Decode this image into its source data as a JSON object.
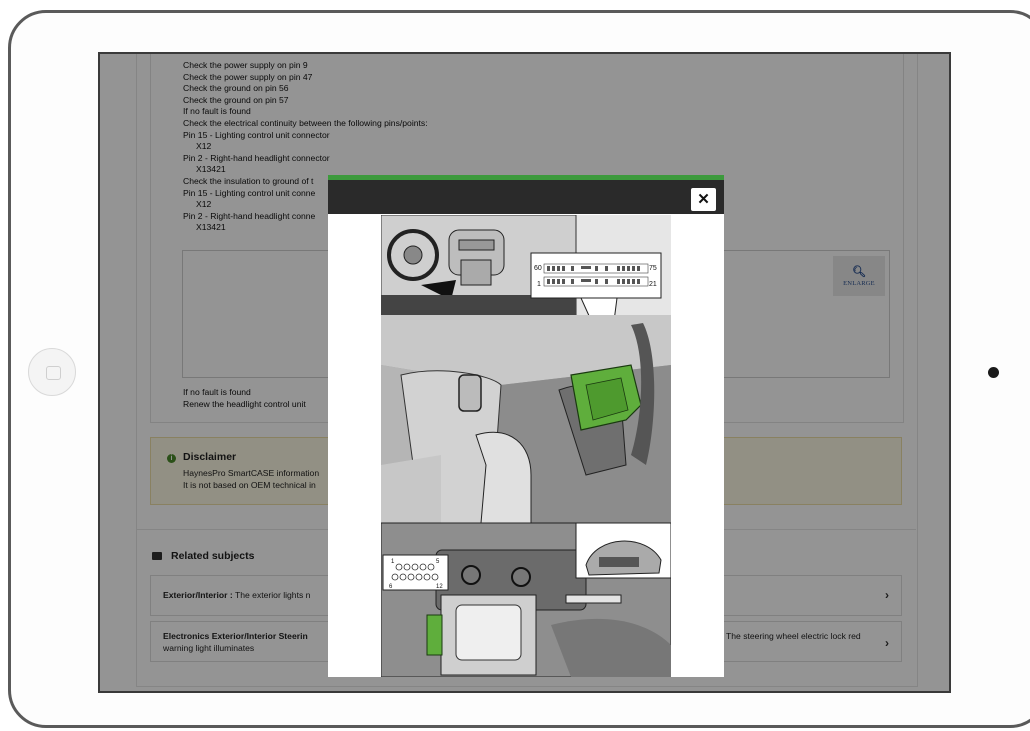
{
  "procedure": {
    "steps": [
      "Check the power supply on pin 9",
      "Check the power supply on pin 47",
      "Check the ground on pin 56",
      "Check the ground on pin 57",
      "If no fault is found",
      "Check the electrical continuity between the following pins/points:",
      "Pin 15 - Lighting control unit connector",
      "X12",
      "Pin 2 - Right-hand headlight connector",
      "X13421",
      "Check the insulation to ground of t",
      "Pin 15 - Lighting control unit conne",
      "X12",
      "Pin 2 - Right-hand headlight conne",
      "X13421"
    ],
    "enlarge_icon": "magnifier-icon",
    "enlarge_label": "ENLARGE",
    "after": [
      "If no fault is found",
      "Renew the headlight control unit"
    ]
  },
  "disclaimer": {
    "icon": "info-icon",
    "title": "Disclaimer",
    "line1": "HaynesPro SmartCASE information",
    "line2": "It is not based on OEM technical in"
  },
  "related": {
    "icon": "folder-icon",
    "title": "Related subjects",
    "items": [
      {
        "bold": "Exterior/Interior :",
        "text": " The exterior lights n",
        "tail": ""
      },
      {
        "bold": "Electronics Exterior/Interior Steerin",
        "text": "",
        "tail": "The steering wheel electric lock red",
        "line2": "warning light illuminates"
      }
    ],
    "chevron": "›"
  },
  "modal": {
    "close_icon": "close-icon",
    "close_label": "✕",
    "connector_top": {
      "left_top": "60",
      "right_top": "75",
      "left_bottom": "1",
      "right_bottom": "21"
    },
    "connector_bottom": {
      "top_left": "1",
      "top_right": "5",
      "bottom_left": "6",
      "bottom_right": "12"
    }
  },
  "colors": {
    "modal_accent": "#3c9a3c",
    "connector_green": "#5fae3c",
    "disclaimer_bg": "#fcf8e3"
  }
}
